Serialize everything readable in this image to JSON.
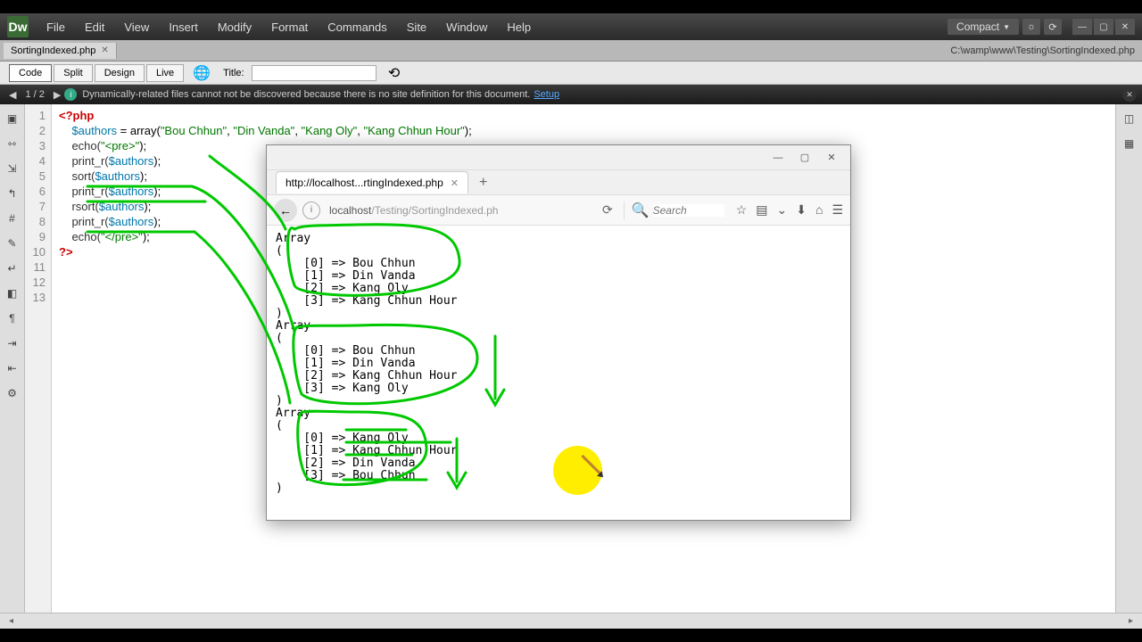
{
  "app": {
    "logo": "Dw"
  },
  "menu": {
    "file": "File",
    "edit": "Edit",
    "view": "View",
    "insert": "Insert",
    "modify": "Modify",
    "format": "Format",
    "commands": "Commands",
    "site": "Site",
    "window": "Window",
    "help": "Help"
  },
  "workspace": {
    "label": "Compact"
  },
  "tabs": {
    "filename": "SortingIndexed.php",
    "filepath": "C:\\wamp\\www\\Testing\\SortingIndexed.php"
  },
  "viewbuttons": {
    "code": "Code",
    "split": "Split",
    "design": "Design",
    "live": "Live"
  },
  "toolbar": {
    "title_label": "Title:"
  },
  "infobar": {
    "pages": "1 / 2",
    "msg": "Dynamically-related files cannot not be discovered because there is no site definition for this document.",
    "setup": "Setup"
  },
  "lines": [
    "1",
    "2",
    "3",
    "4",
    "5",
    "6",
    "7",
    "8",
    "9",
    "10",
    "11",
    "12",
    "13"
  ],
  "code": {
    "l1": "<?php",
    "l2a": "$authors",
    "l2b": " = array(",
    "l2c": "\"Bou Chhun\"",
    "l2d": ", ",
    "l2e": "\"Din Vanda\"",
    "l2f": ", ",
    "l2g": "\"Kang Oly\"",
    "l2h": ", ",
    "l2i": "\"Kang Chhun Hour\"",
    "l2j": ");",
    "l3a": "echo(",
    "l3b": "\"<pre>\"",
    "l3c": ");",
    "l4a": "print_r(",
    "l4b": "$authors",
    "l4c": ");",
    "l5": "",
    "l6a": "sort(",
    "l6b": "$authors",
    "l6c": ");",
    "l7a": "print_r(",
    "l7b": "$authors",
    "l7c": ");",
    "l8": "",
    "l9a": "rsort(",
    "l9b": "$authors",
    "l9c": ");",
    "l10a": "print_r(",
    "l10b": "$authors",
    "l10c": ");",
    "l11a": "echo(",
    "l11b": "\"</pre>\"",
    "l11c": ");",
    "l12": "",
    "l13": "?>"
  },
  "browser": {
    "tab_title": "http://localhost...rtingIndexed.php",
    "url_host": "localhost",
    "url_path": "/Testing/SortingIndexed.ph",
    "search_placeholder": "Search",
    "output": "Array\n(\n    [0] => Bou Chhun\n    [1] => Din Vanda\n    [2] => Kang Oly\n    [3] => Kang Chhun Hour\n)\nArray\n(\n    [0] => Bou Chhun\n    [1] => Din Vanda\n    [2] => Kang Chhun Hour\n    [3] => Kang Oly\n)\nArray\n(\n    [0] => Kang Oly\n    [1] => Kang Chhun Hour\n    [2] => Din Vanda\n    [3] => Bou Chhun\n)"
  }
}
